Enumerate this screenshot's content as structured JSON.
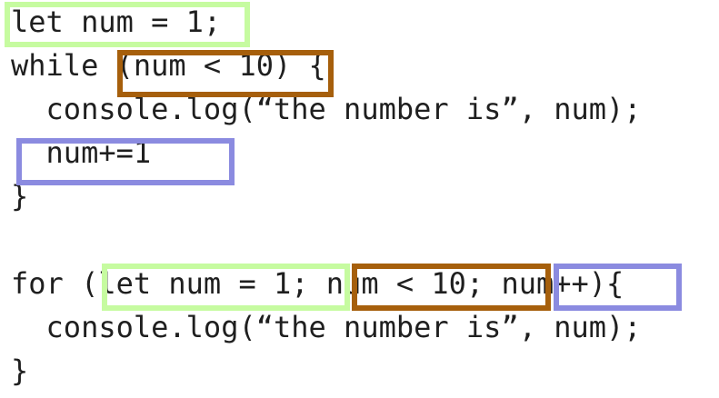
{
  "code_lines": [
    "let num = 1;",
    "while (num < 10) {",
    "  console.log(“the number is”, num);",
    "  num+=1",
    "}",
    "",
    "for (let num = 1; num < 10; num++){",
    "  console.log(“the number is”, num);",
    "}"
  ],
  "colors": {
    "initialization": "#c6fba0",
    "condition": "#a65f0c",
    "update": "#8b8be0",
    "text": "#1f1f1f",
    "background": "#ffffff"
  }
}
